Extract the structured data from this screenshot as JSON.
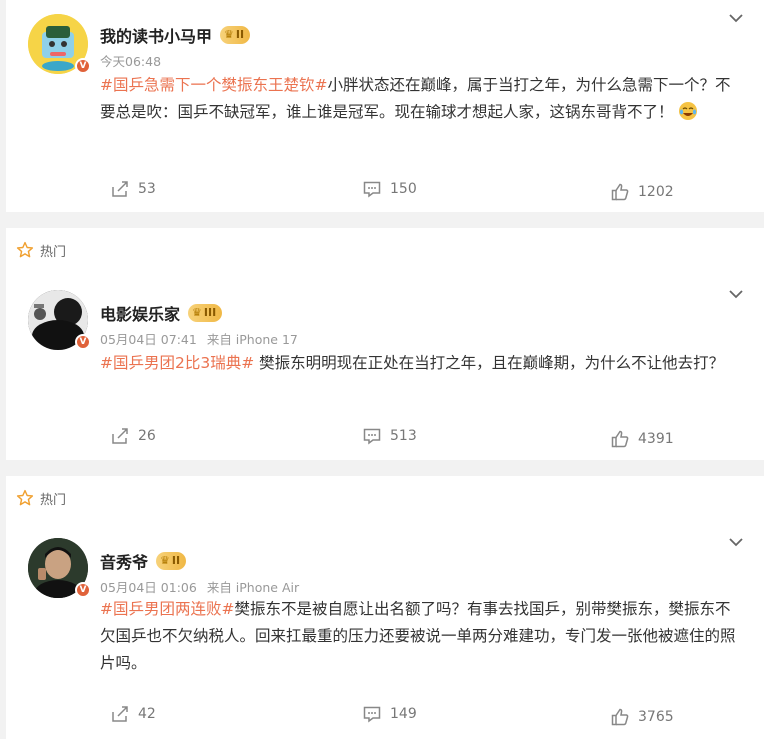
{
  "colors": {
    "hashtag": "#eb7350",
    "verified_badge": "#e0623a",
    "level_badge": "#f0b845",
    "hot_star": "#f0a030"
  },
  "posts": [
    {
      "hot_label": "",
      "user": "我的读书小马甲",
      "level": "II",
      "time": "今天06:48",
      "source": "",
      "hashtag": "#国乒急需下一个樊振东王楚钦#",
      "body": "小胖状态还在巅峰，属于当打之年，为什么急需下一个？不要总是吹：国乒不缺冠军，谁上谁是冠军。现在输球才想起人家，这锅东哥背不了！",
      "trailing_emoji": "crying-laughing-emoji",
      "reposts": "53",
      "comments": "150",
      "likes": "1202"
    },
    {
      "hot_label": "热门",
      "user": "电影娱乐家",
      "level": "III",
      "time": "05月04日 07:41",
      "source": "来自 iPhone 17",
      "hashtag": "#国乒男团2比3瑞典#",
      "body": " 樊振东明明现在正处在当打之年，且在巅峰期，为什么不让他去打？",
      "reposts": "26",
      "comments": "513",
      "likes": "4391"
    },
    {
      "hot_label": "热门",
      "user": "音秀爷",
      "level": "II",
      "time": "05月04日 01:06",
      "source": "来自 iPhone Air",
      "hashtag": "#国乒男团两连败#",
      "body": "樊振东不是被自愿让出名额了吗？有事去找国乒，别带樊振东，樊振东不欠国乒也不欠纳税人。回来扛最重的压力还要被说一单两分难建功，专门发一张他被遮住的照片吗。",
      "reposts": "42",
      "comments": "149",
      "likes": "3765"
    }
  ]
}
